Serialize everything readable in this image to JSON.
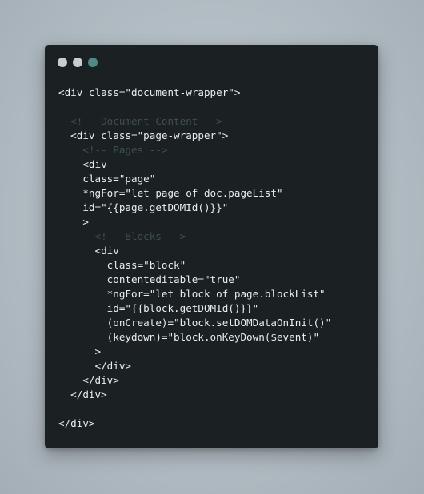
{
  "window": {
    "controls": [
      {
        "name": "close",
        "color": "#c8cdd0"
      },
      {
        "name": "minimize",
        "color": "#c8cdd0"
      },
      {
        "name": "maximize",
        "color": "#4f8a86"
      }
    ]
  },
  "code": {
    "lines": [
      {
        "text": "<div class=\"document-wrapper\">",
        "kind": "code"
      },
      {
        "text": "",
        "kind": "code"
      },
      {
        "text": "  <!-- Document Content -->",
        "kind": "comment"
      },
      {
        "text": "  <div class=\"page-wrapper\">",
        "kind": "code"
      },
      {
        "text": "    <!-- Pages -->",
        "kind": "comment"
      },
      {
        "text": "    <div",
        "kind": "code"
      },
      {
        "text": "    class=\"page\"",
        "kind": "code"
      },
      {
        "text": "    *ngFor=\"let page of doc.pageList\"",
        "kind": "code"
      },
      {
        "text": "    id=\"{{page.getDOMId()}}\"",
        "kind": "code"
      },
      {
        "text": "    >",
        "kind": "code"
      },
      {
        "text": "      <!-- Blocks -->",
        "kind": "comment"
      },
      {
        "text": "      <div",
        "kind": "code"
      },
      {
        "text": "        class=\"block\"",
        "kind": "code"
      },
      {
        "text": "        contenteditable=\"true\"",
        "kind": "code"
      },
      {
        "text": "        *ngFor=\"let block of page.blockList\"",
        "kind": "code"
      },
      {
        "text": "        id=\"{{block.getDOMId()}}\"",
        "kind": "code"
      },
      {
        "text": "        (onCreate)=\"block.setDOMDataOnInit()\"",
        "kind": "code"
      },
      {
        "text": "        (keydown)=\"block.onKeyDown($event)\"",
        "kind": "code"
      },
      {
        "text": "      >",
        "kind": "code"
      },
      {
        "text": "      </div>",
        "kind": "code"
      },
      {
        "text": "    </div>",
        "kind": "code"
      },
      {
        "text": "  </div>",
        "kind": "code"
      },
      {
        "text": "",
        "kind": "code"
      },
      {
        "text": "</div>",
        "kind": "code"
      }
    ]
  }
}
